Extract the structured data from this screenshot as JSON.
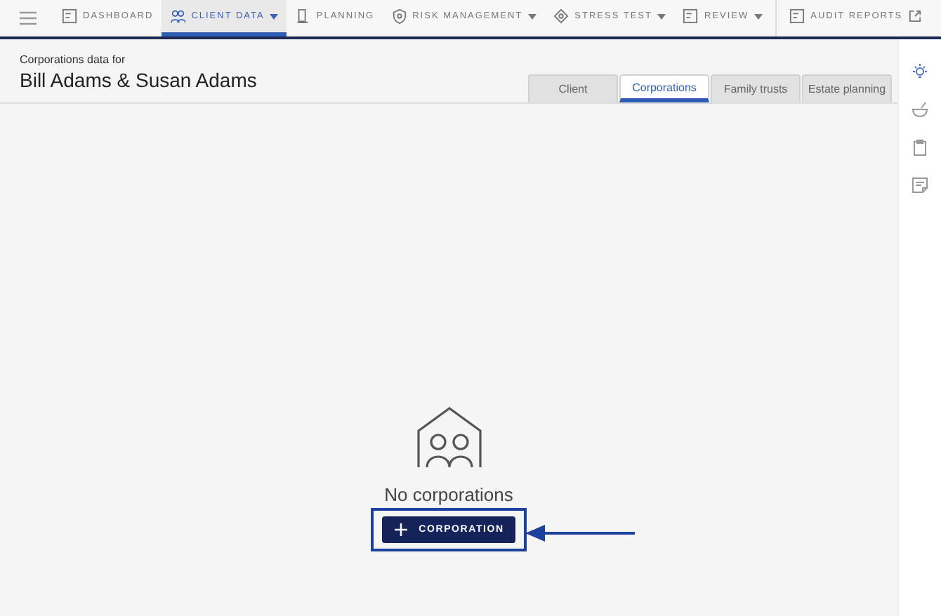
{
  "nav": {
    "items": [
      {
        "label": "DASHBOARD",
        "dropdown": false,
        "external": false,
        "selected": false
      },
      {
        "label": "CLIENT DATA",
        "dropdown": true,
        "external": false,
        "selected": true
      },
      {
        "label": "PLANNING",
        "dropdown": false,
        "external": false,
        "selected": false
      },
      {
        "label": "RISK MANAGEMENT",
        "dropdown": true,
        "external": false,
        "selected": false
      },
      {
        "label": "STRESS TEST",
        "dropdown": true,
        "external": false,
        "selected": false
      },
      {
        "label": "REVIEW",
        "dropdown": true,
        "external": false,
        "selected": false
      },
      {
        "label": "AUDIT REPORTS",
        "dropdown": false,
        "external": true,
        "selected": false
      }
    ]
  },
  "header": {
    "subtitle": "Corporations data for",
    "title": "Bill Adams & Susan Adams"
  },
  "tabs": [
    {
      "label": "Client",
      "selected": false
    },
    {
      "label": "Corporations",
      "selected": true
    },
    {
      "label": "Family trusts",
      "selected": false
    },
    {
      "label": "Estate planning",
      "selected": false
    }
  ],
  "empty_state": {
    "message": "No corporations",
    "button": "CORPORATION"
  },
  "rail": [
    {
      "selected": true
    },
    {
      "selected": false
    },
    {
      "selected": false
    },
    {
      "selected": false
    }
  ]
}
